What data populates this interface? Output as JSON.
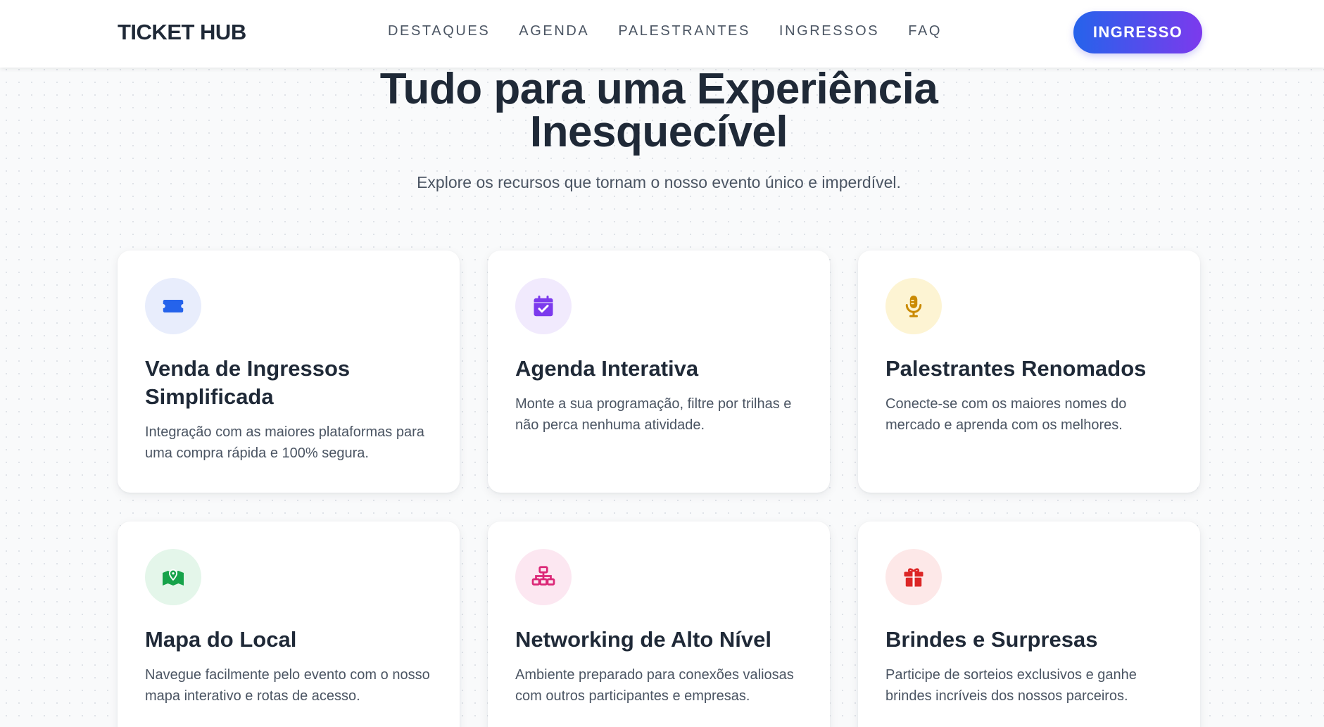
{
  "navbar": {
    "logo": "TICKET HUB",
    "links": [
      "DESTAQUES",
      "AGENDA",
      "PALESTRANTES",
      "INGRESSOS",
      "FAQ"
    ],
    "cta_label": "INGRESSO",
    "cta_gradient": [
      "#2563eb",
      "#7c3aed"
    ]
  },
  "section": {
    "title_line1": "Tudo para uma Experiência",
    "title_line2": "Inesquecível",
    "subtitle": "Explore os recursos que tornam o nosso evento único e imperdível."
  },
  "features": [
    {
      "icon": "ticket-icon",
      "icon_color": "#2563eb",
      "icon_bg": "#e8edfc",
      "title": "Venda de Ingressos Simplificada",
      "description": "Integração com as maiores plataformas para uma compra rápida e 100% segura."
    },
    {
      "icon": "calendar-check-icon",
      "icon_color": "#7c3aed",
      "icon_bg": "#f1eafd",
      "title": "Agenda Interativa",
      "description": "Monte a sua programação, filtre por trilhas e não perca nenhuma atividade."
    },
    {
      "icon": "microphone-icon",
      "icon_color": "#ca8a04",
      "icon_bg": "#fdf4d3",
      "title": "Palestrantes Renomados",
      "description": "Conecte-se com os maiores nomes do mercado e aprenda com os melhores."
    },
    {
      "icon": "map-pin-icon",
      "icon_color": "#16a34a",
      "icon_bg": "#e4f6ea",
      "title": "Mapa do Local",
      "description": "Navegue facilmente pelo evento com o nosso mapa interativo e rotas de acesso."
    },
    {
      "icon": "network-icon",
      "icon_color": "#db2777",
      "icon_bg": "#fce7f1",
      "title": "Networking de Alto Nível",
      "description": "Ambiente preparado para conexões valiosas com outros participantes e empresas."
    },
    {
      "icon": "gift-icon",
      "icon_color": "#dc2626",
      "icon_bg": "#fde8e8",
      "title": "Brindes e Surpresas",
      "description": "Participe de sorteios exclusivos e ganhe brindes incríveis dos nossos parceiros."
    }
  ]
}
